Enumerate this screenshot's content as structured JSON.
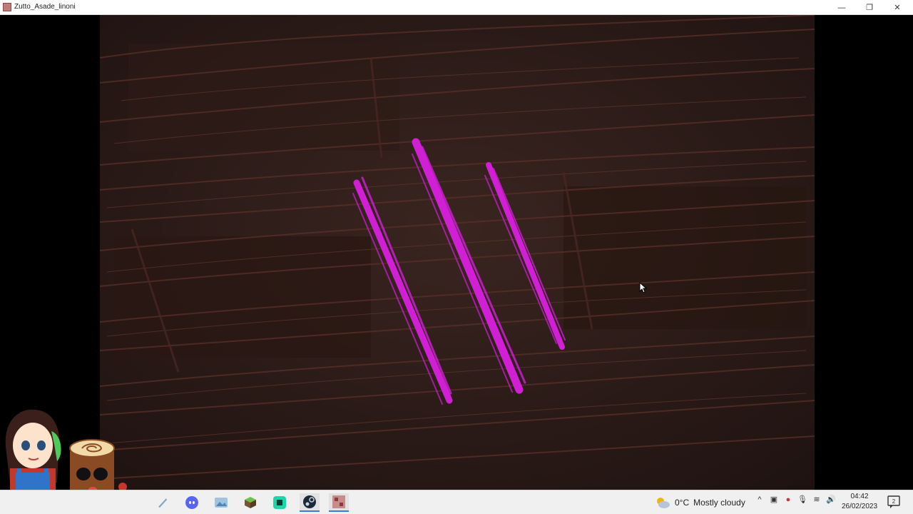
{
  "window": {
    "title": "Zutto_Asade_linoni",
    "controls": {
      "minimize": "—",
      "restore": "❐",
      "close": "✕"
    }
  },
  "taskbar": {
    "apps": [
      {
        "name": "quill-app-icon"
      },
      {
        "name": "discord-icon"
      },
      {
        "name": "photos-icon"
      },
      {
        "name": "minecraft-icon"
      },
      {
        "name": "terminal-icon"
      },
      {
        "name": "steam-icon"
      },
      {
        "name": "game-window-icon"
      }
    ],
    "weather": {
      "temperature": "0°C",
      "condition": "Mostly cloudy"
    },
    "tray": {
      "chevron": "^"
    },
    "clock": {
      "time": "04:42",
      "date": "26/02/2023"
    },
    "notification_count": "2"
  },
  "colors": {
    "scratch": "#d11fd6",
    "wood": "#2c1b17",
    "grain": "#4a2a22"
  }
}
